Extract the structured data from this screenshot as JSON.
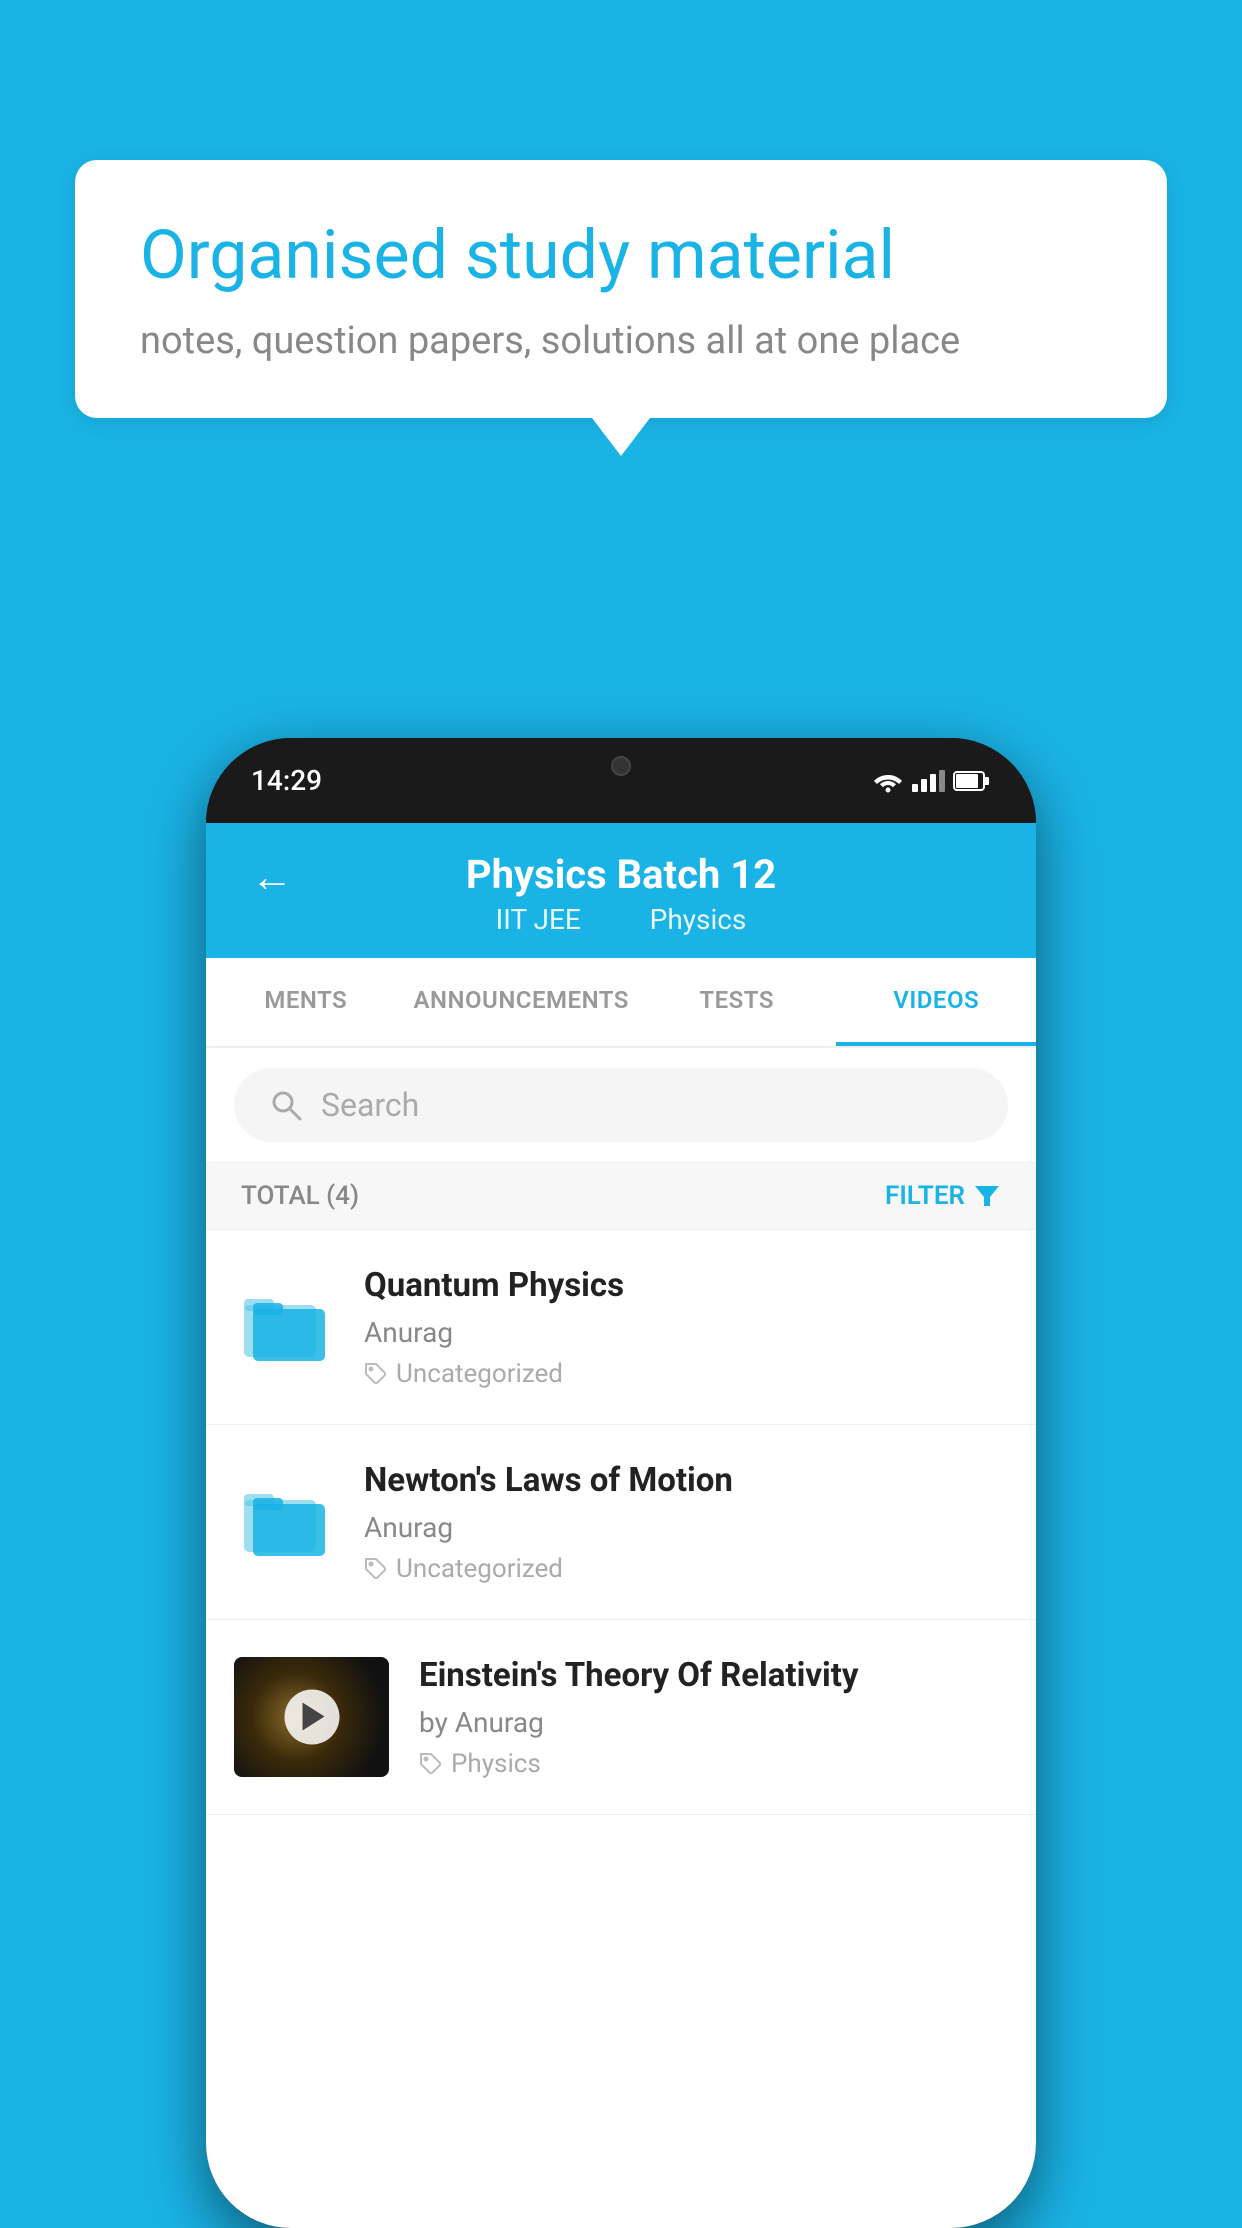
{
  "background": {
    "color": "#1ab3e6"
  },
  "speech_bubble": {
    "title": "Organised study material",
    "subtitle": "notes, question papers, solutions all at one place"
  },
  "phone": {
    "status_bar": {
      "time": "14:29"
    },
    "header": {
      "title": "Physics Batch 12",
      "subtitle_part1": "IIT JEE",
      "subtitle_part2": "Physics",
      "back_label": "←"
    },
    "tabs": [
      {
        "label": "MENTS",
        "active": false
      },
      {
        "label": "ANNOUNCEMENTS",
        "active": false
      },
      {
        "label": "TESTS",
        "active": false
      },
      {
        "label": "VIDEOS",
        "active": true
      }
    ],
    "search": {
      "placeholder": "Search"
    },
    "filter_bar": {
      "total_label": "TOTAL (4)",
      "filter_label": "FILTER"
    },
    "videos": [
      {
        "id": 1,
        "title": "Quantum Physics",
        "author": "Anurag",
        "tag": "Uncategorized",
        "has_thumbnail": false
      },
      {
        "id": 2,
        "title": "Newton's Laws of Motion",
        "author": "Anurag",
        "tag": "Uncategorized",
        "has_thumbnail": false
      },
      {
        "id": 3,
        "title": "Einstein's Theory Of Relativity",
        "author": "by Anurag",
        "tag": "Physics",
        "has_thumbnail": true
      }
    ]
  }
}
